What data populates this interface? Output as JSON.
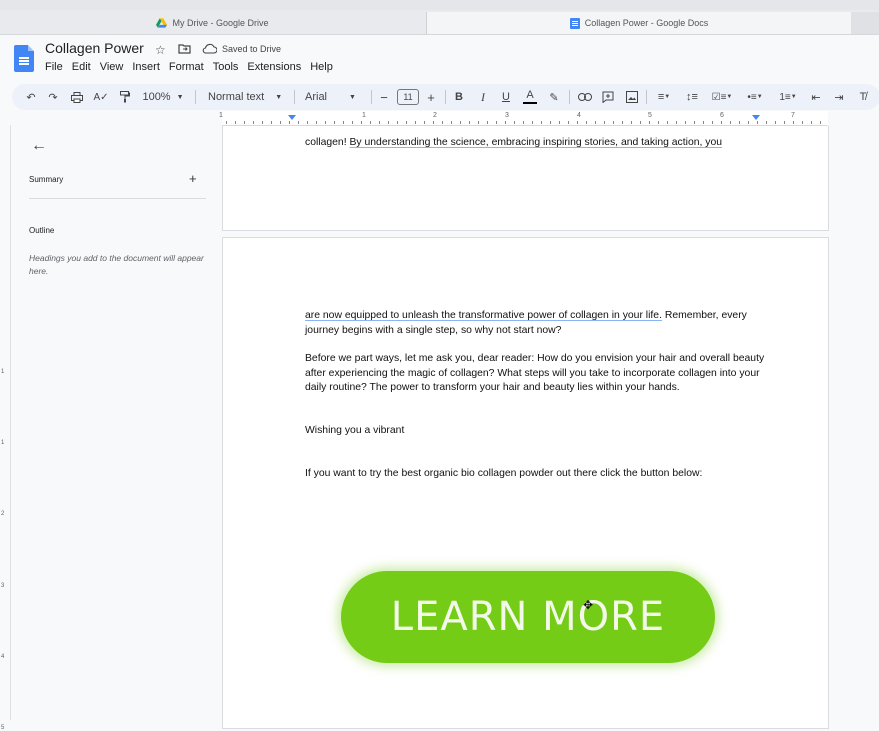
{
  "browser": {
    "tabs": [
      {
        "title": "My Drive - Google Drive"
      },
      {
        "title": "Collagen Power - Google Docs"
      }
    ]
  },
  "doc": {
    "title": "Collagen Power",
    "saved_status": "Saved to Drive",
    "menu": [
      "File",
      "Edit",
      "View",
      "Insert",
      "Format",
      "Tools",
      "Extensions",
      "Help"
    ]
  },
  "toolbar": {
    "zoom": "100%",
    "style": "Normal text",
    "font": "Arial",
    "font_size": "11",
    "bold": "B",
    "italic": "I",
    "underline": "U",
    "text_color": "A"
  },
  "ruler": {
    "numbers": [
      "1",
      "1",
      "2",
      "3",
      "4",
      "5",
      "6",
      "7"
    ]
  },
  "vruler": {
    "numbers": [
      "1",
      "1",
      "2",
      "3",
      "4",
      "5"
    ]
  },
  "sidebar": {
    "summary_label": "Summary",
    "add_symbol": "+",
    "outline_label": "Outline",
    "outline_hint": "Headings you add to the document will appear here."
  },
  "content": {
    "page1_line_a": "collagen! ",
    "page1_line_b": "By understanding the science, embracing inspiring stories, and taking action, you",
    "p1a": "are now equipped to unleash the transformative power of collagen in your life.",
    "p1b": " Remember, every journey begins with a single step, so why not start now?",
    "p2": "Before we part ways, let me ask you, dear reader: How do you envision your hair and overall beauty after experiencing the magic of collagen? What steps will you take to incorporate collagen into your daily routine? The power to transform your hair and beauty lies within your hands.",
    "p3": "Wishing you a vibrant",
    "p4": "If you want to try the best organic bio collagen powder out there click the button below:",
    "button_label": "LEARN MORE"
  },
  "colors": {
    "button": "#74cc16",
    "accent": "#4285f4"
  }
}
